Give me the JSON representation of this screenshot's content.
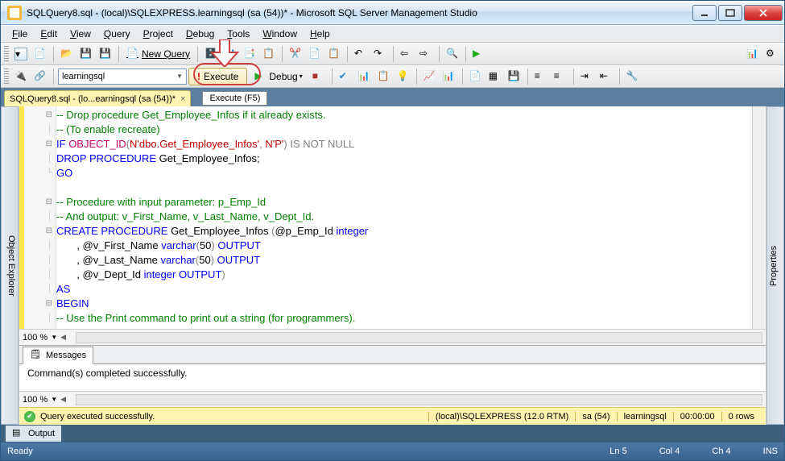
{
  "window": {
    "title": "SQLQuery8.sql - (local)\\SQLEXPRESS.learningsql (sa (54))* - Microsoft SQL Server Management Studio"
  },
  "menu": [
    "File",
    "Edit",
    "View",
    "Query",
    "Project",
    "Debug",
    "Tools",
    "Window",
    "Help"
  ],
  "toolbar1": {
    "newquery": "New Query"
  },
  "toolbar2": {
    "database": "learningsql",
    "execute": "Execute",
    "debug": "Debug"
  },
  "tabs": {
    "active": "SQLQuery8.sql - (lo...earningsql (sa (54))*",
    "tooltip": "Execute (F5)"
  },
  "side": {
    "left": "Object Explorer",
    "right": "Properties"
  },
  "code": {
    "l1": "-- Drop procedure Get_Employee_Infos if it already exists.",
    "l2": "-- (To enable recreate)",
    "l3a": "IF",
    "l3b": "OBJECT_ID",
    "l3c": "(",
    "l3d": "N'dbo.Get_Employee_Infos'",
    "l3e": ", ",
    "l3f": "N'P'",
    "l3g": ")",
    "l3h": " IS NOT NULL",
    "l4a": "DROP",
    "l4b": " PROCEDURE",
    "l4c": " Get_Employee_Infos;",
    "l5": "GO",
    "l7": "-- Procedure with input parameter: p_Emp_Id",
    "l8": "-- And output: v_First_Name, v_Last_Name, v_Dept_Id.",
    "l9a": "CREATE",
    "l9b": " PROCEDURE",
    "l9c": " Get_Employee_Infos ",
    "l9d": "(",
    "l9e": "@p_Emp_Id ",
    "l9f": "integer",
    "l10a": "       , @v_First_Name ",
    "l10b": "varchar",
    "l10c": "(",
    "l10d": "50",
    "l10e": ")",
    "l10f": " OUTPUT",
    "l11a": "       , @v_Last_Name ",
    "l11b": "varchar",
    "l11c": "(",
    "l11d": "50",
    "l11e": ")",
    "l11f": " OUTPUT",
    "l12a": "       , @v_Dept_Id ",
    "l12b": "integer",
    "l12c": " OUTPUT",
    "l12d": ")",
    "l13": "AS",
    "l14": "BEGIN",
    "l15": "-- Use the Print command to print out a string (for programmers)."
  },
  "zoom": "100 %",
  "messages": {
    "tab": "Messages",
    "text": "Command(s) completed successfully."
  },
  "qstatus": {
    "text": "Query executed successfully.",
    "server": "(local)\\SQLEXPRESS (12.0 RTM)",
    "user": "sa (54)",
    "db": "learningsql",
    "time": "00:00:00",
    "rows": "0 rows"
  },
  "output": {
    "tab": "Output"
  },
  "status": {
    "ready": "Ready",
    "ln": "Ln 5",
    "col": "Col 4",
    "ch": "Ch 4",
    "ins": "INS"
  }
}
